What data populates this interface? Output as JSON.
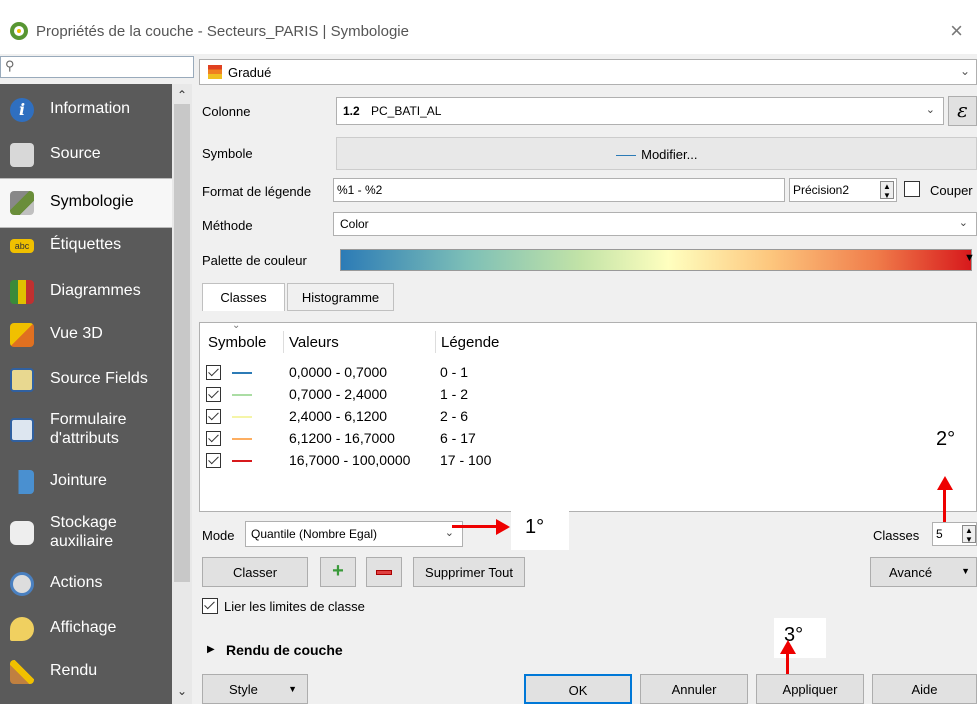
{
  "window": {
    "title": "Propriétés de la couche - Secteurs_PARIS | Symbologie",
    "close_glyph": "×"
  },
  "search": {
    "placeholder": ""
  },
  "sidebar": {
    "items": [
      {
        "label": "Information",
        "icon": "info-icon"
      },
      {
        "label": "Source",
        "icon": "source-icon"
      },
      {
        "label": "Symbologie",
        "icon": "paintbrush-icon"
      },
      {
        "label": "Étiquettes",
        "icon": "abc-label-icon"
      },
      {
        "label": "Diagrammes",
        "icon": "diagram-icon"
      },
      {
        "label": "Vue 3D",
        "icon": "cube-icon"
      },
      {
        "label": "Source Fields",
        "icon": "fields-icon"
      },
      {
        "label": "Formulaire d'attributs",
        "icon": "form-icon"
      },
      {
        "label": "Jointure",
        "icon": "join-icon"
      },
      {
        "label": "Stockage auxiliaire",
        "icon": "storage-icon"
      },
      {
        "label": "Actions",
        "icon": "actions-icon"
      },
      {
        "label": "Affichage",
        "icon": "tooltip-icon"
      },
      {
        "label": "Rendu",
        "icon": "rendering-icon"
      }
    ],
    "active": "Symbologie"
  },
  "renderer": {
    "selected": "Gradué"
  },
  "form": {
    "colonne_label": "Colonne",
    "colonne_type": "1.2",
    "colonne_value": "PC_BATI_AL",
    "expression_glyph": "ε",
    "symbole_label": "Symbole",
    "modifier_label": "Modifier...",
    "format_label": "Format de légende",
    "format_value": "%1 - %2",
    "precision_label": "Précision",
    "precision_value": "2",
    "couper_label": "Couper",
    "methode_label": "Méthode",
    "methode_value": "Color",
    "palette_label": "Palette de couleur"
  },
  "tabs": [
    {
      "label": "Classes"
    },
    {
      "label": "Histogramme"
    }
  ],
  "classes_table": {
    "headers": {
      "symbole": "Symbole",
      "valeurs": "Valeurs",
      "legende": "Légende"
    },
    "rows": [
      {
        "valeurs": "0,0000 - 0,7000",
        "legende": "0 - 1",
        "color": "#2c7bb6"
      },
      {
        "valeurs": "0,7000 - 2,4000",
        "legende": "1 - 2",
        "color": "#abdda4"
      },
      {
        "valeurs": "2,4000 - 6,1200",
        "legende": "2 - 6",
        "color": "#ffffbf"
      },
      {
        "valeurs": "6,1200 - 16,7000",
        "legende": "6 - 17",
        "color": "#fdae61"
      },
      {
        "valeurs": "16,7000 - 100,0000",
        "legende": "17 - 100",
        "color": "#d7191c"
      }
    ]
  },
  "mode": {
    "label": "Mode",
    "value": "Quantile (Nombre Egal)"
  },
  "classes_count": {
    "label": "Classes",
    "value": "5"
  },
  "actions": {
    "classer": "Classer",
    "supprimer_tout": "Supprimer Tout",
    "avance": "Avancé"
  },
  "lier": {
    "label": "Lier les limites de classe"
  },
  "rendu": {
    "label": "Rendu de couche"
  },
  "annotations": {
    "n1": "1°",
    "n2": "2°",
    "n3": "3°"
  },
  "footer": {
    "style": "Style",
    "ok": "OK",
    "annuler": "Annuler",
    "appliquer": "Appliquer",
    "aide": "Aide"
  },
  "colors": {
    "sidebar_bg": "#5a5a5a",
    "arrow": "#e00000"
  }
}
